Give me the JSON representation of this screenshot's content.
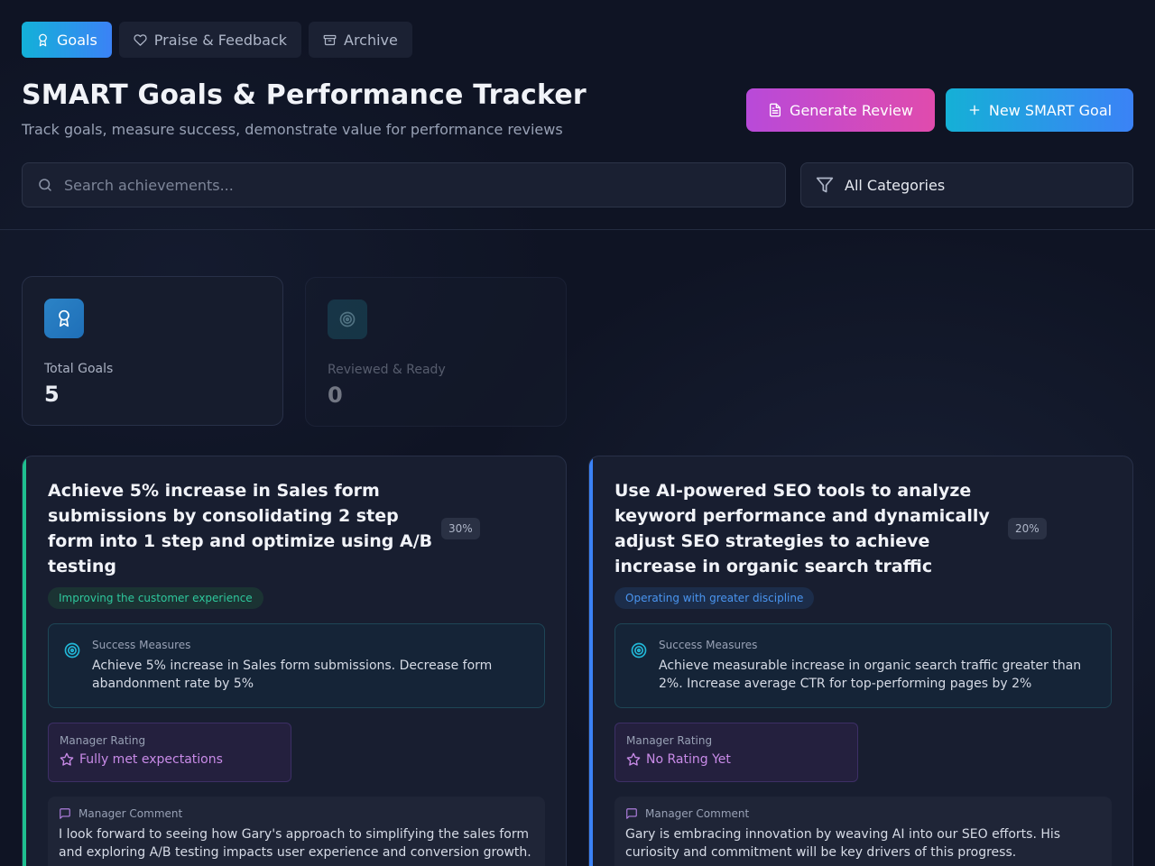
{
  "tabs": [
    {
      "label": "Goals",
      "icon": "award-icon",
      "active": true
    },
    {
      "label": "Praise & Feedback",
      "icon": "heart-icon",
      "active": false
    },
    {
      "label": "Archive",
      "icon": "archive-icon",
      "active": false
    }
  ],
  "header": {
    "title": "SMART Goals & Performance Tracker",
    "subtitle": "Track goals, measure success, demonstrate value for performance reviews",
    "generate_review_label": "Generate Review",
    "new_goal_label": "New SMART Goal"
  },
  "search": {
    "placeholder": "Search achievements..."
  },
  "filter": {
    "selected": "All Categories"
  },
  "stats": [
    {
      "label": "Total Goals",
      "value": "5",
      "icon": "award-icon"
    },
    {
      "label": "Reviewed & Ready",
      "value": "0",
      "icon": "target-icon"
    }
  ],
  "goals": [
    {
      "title": "Achieve 5% increase in Sales form submissions by consolidating 2 step form into 1 step and optimize using A/B testing",
      "progress": "30%",
      "category": "Improving the customer experience",
      "measures_label": "Success Measures",
      "measures": "Achieve 5% increase in Sales form submissions. Decrease form abandonment rate by 5%",
      "rating_label": "Manager Rating",
      "rating": "Fully met expectations",
      "comment_label": "Manager Comment",
      "comment": "I look forward to seeing how Gary's approach to simplifying the sales form and exploring A/B testing impacts user experience and conversion growth."
    },
    {
      "title": "Use AI-powered SEO tools to analyze keyword performance and dynamically adjust SEO strategies to achieve increase in organic search traffic",
      "progress": "20%",
      "category": "Operating with greater discipline",
      "measures_label": "Success Measures",
      "measures": "Achieve measurable increase in organic search traffic greater than 2%. Increase average CTR for top-performing pages by 2%",
      "rating_label": "Manager Rating",
      "rating": "No Rating Yet",
      "comment_label": "Manager Comment",
      "comment": "Gary is embracing innovation by weaving AI into our SEO efforts. His curiosity and commitment will be key drivers of this progress."
    }
  ],
  "colors": {
    "accent": "#13b1d8",
    "review_gradient_start": "#b84ad9",
    "goal1_bar": "#1fbf8f",
    "goal2_bar": "#3b82f6"
  }
}
